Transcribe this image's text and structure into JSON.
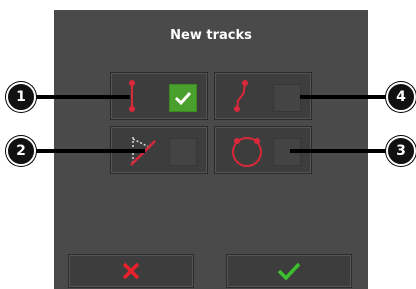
{
  "dialog": {
    "title": "New tracks"
  },
  "options": [
    {
      "id": "straight",
      "callout": "1",
      "icon": "straight-line-track-icon",
      "checked": true
    },
    {
      "id": "curve",
      "callout": "4",
      "icon": "curve-track-icon",
      "checked": false
    },
    {
      "id": "angle",
      "callout": "2",
      "icon": "angle-track-icon",
      "checked": false
    },
    {
      "id": "circle",
      "callout": "3",
      "icon": "circle-track-icon",
      "checked": false
    }
  ],
  "buttons": {
    "cancel_icon": "cancel-x-icon",
    "confirm_icon": "confirm-check-icon"
  },
  "colors": {
    "accent_green": "#4aa02c",
    "cancel_red": "#e8202a",
    "confirm_green": "#3cc02e",
    "track_red": "#d8283a"
  }
}
